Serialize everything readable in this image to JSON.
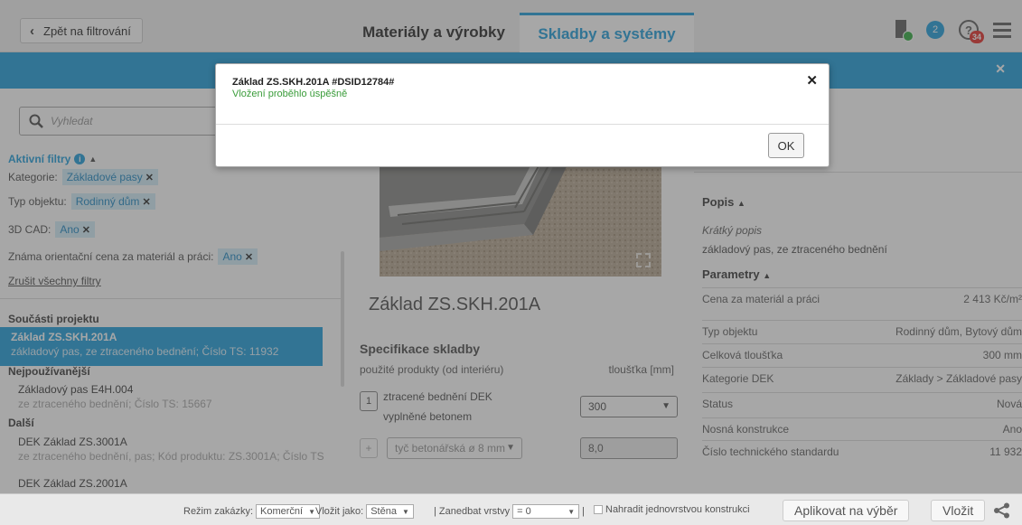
{
  "header": {
    "back_label": "Zpět na filtrování",
    "tabs": [
      {
        "label": "Materiály a výrobky",
        "active": false
      },
      {
        "label": "Skladby a systémy",
        "active": true
      }
    ],
    "notification_count": "2",
    "help_badge": "34"
  },
  "left": {
    "search_placeholder": "Vyhledat",
    "filters_title": "Aktivní filtry",
    "filters": [
      {
        "label": "Kategorie:",
        "value": "Základové pasy"
      },
      {
        "label": "Typ objektu:",
        "value": "Rodinný dům"
      },
      {
        "label": "3D CAD:",
        "value": "Ano"
      },
      {
        "label": "Známa orientační cena za materiál a práci:",
        "value": "Ano"
      }
    ],
    "clear_filters": "Zrušit všechny filtry",
    "sections": {
      "project": "Součásti projektu",
      "most_used": "Nejpoužívanější",
      "other": "Další"
    },
    "selected": {
      "title": "Základ ZS.SKH.201A",
      "sub": "základový pas, ze ztraceného bednění; Číslo TS: 11932"
    },
    "most_used_items": [
      {
        "title": "Základový pas E4H.004",
        "sub": "ze ztraceného bednění; Číslo TS: 15667"
      }
    ],
    "other_items": [
      {
        "title": "DEK Základ ZS.3001A",
        "sub": "ze ztraceného bednění, pas; Kód produktu: ZS.3001A; Číslo TS"
      },
      {
        "title": "DEK Základ ZS.2001A",
        "sub": ""
      }
    ]
  },
  "middle": {
    "object_title": "Základ ZS.SKH.201A",
    "spec_heading": "Specifikace skladby",
    "col_products": "použité produkty (od interiéru)",
    "col_thickness": "tloušťka [mm]",
    "layer_number": "1",
    "layer_name": "ztracené bednění DEK vyplněné betonem",
    "layer_thickness": "300",
    "add_symbol": "+",
    "rebar_placeholder": "tyč betonářská ø 8 mm",
    "rebar_value": "8,0"
  },
  "right": {
    "popis_heading": "Popis",
    "short_label": "Krátký popis",
    "short_desc": "základový pas, ze ztraceného bednění",
    "params_heading": "Parametry",
    "params": [
      {
        "key": "Cena za materiál a práci",
        "value": "2 413 Kč/m²"
      },
      {
        "key": "Typ objektu",
        "value": "Rodinný dům, Bytový dům"
      },
      {
        "key": "Celková tloušťka",
        "value": "300 mm"
      },
      {
        "key": "Kategorie DEK",
        "value": "Základy > Základové pasy"
      },
      {
        "key": "Status",
        "value": "Nová"
      },
      {
        "key": "Nosná konstrukce",
        "value": "Ano"
      },
      {
        "key": "Číslo technického standardu",
        "value": "11 932"
      }
    ]
  },
  "bottombar": {
    "mode_label": "Režim zakázky:",
    "mode_value": "Komerční",
    "insert_as_label": "Vložit jako:",
    "insert_as_value": "Stěna",
    "ignore_label": "| Zanedbat vrstvy",
    "ignore_value": "= 0",
    "pipe": "|",
    "replace_label": "Nahradit jednovrstvou konstrukci",
    "apply_label": "Aplikovat na výběr",
    "insert_label": "Vložit"
  },
  "modal": {
    "title": "Základ ZS.SKH.201A #DSID12784#",
    "message": "Vložení proběhlo úspěšně",
    "ok_label": "OK"
  },
  "colors": {
    "accent": "#2ba3dd",
    "success": "#3a9c3a",
    "badge_red": "#e53935"
  }
}
